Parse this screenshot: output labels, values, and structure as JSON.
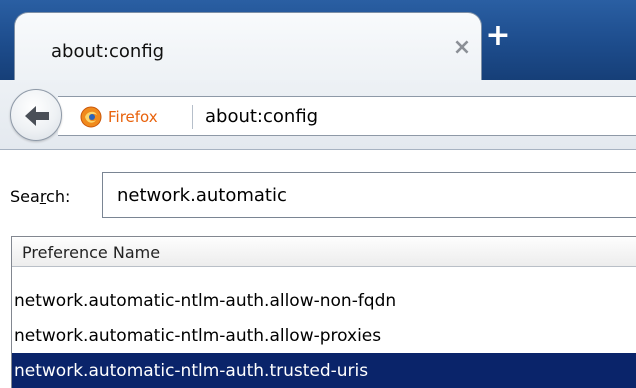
{
  "tab": {
    "title": "about:config",
    "close_glyph": "×",
    "new_tab_glyph": "+"
  },
  "navbar": {
    "identity_label": "Firefox",
    "url": "about:config"
  },
  "search": {
    "label_pre": "Sea",
    "label_underlined": "r",
    "label_post": "ch:",
    "value": "network.automatic"
  },
  "table": {
    "column_header": "Preference Name",
    "rows": [
      {
        "name": "network.automatic-ntlm-auth.allow-non-fqdn",
        "selected": false
      },
      {
        "name": "network.automatic-ntlm-auth.allow-proxies",
        "selected": false
      },
      {
        "name": "network.automatic-ntlm-auth.trusted-uris",
        "selected": true
      }
    ]
  },
  "colors": {
    "tabbar_bg": "#1d4c8c",
    "selection_bg": "#0a246a",
    "identity_orange": "#e8620c"
  },
  "icons": {
    "back": "back-arrow-icon",
    "identity": "firefox-icon",
    "close_tab": "close-icon",
    "new_tab": "plus-icon"
  }
}
